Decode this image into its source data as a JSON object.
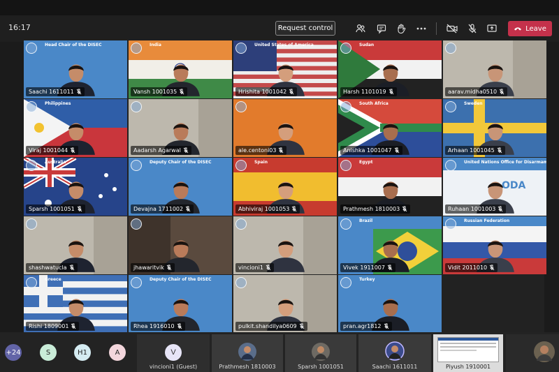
{
  "toolbar": {
    "clock": "16:17",
    "request_control": "Request control",
    "leave": "Leave",
    "icons": [
      "people-icon",
      "chat-icon",
      "raise-hand-icon",
      "more-icon",
      "camera-off-icon",
      "mic-off-icon",
      "share-tray-icon",
      "phone-icon"
    ],
    "leave_color": "#c4314b"
  },
  "tiles": [
    {
      "name": "Saachi 1611011",
      "title": "Head Chair of the DISEC",
      "flag": "un"
    },
    {
      "name": "Vansh 1001035",
      "title": "India",
      "flag": "india"
    },
    {
      "name": "Hrishita 1001042",
      "title": "United States of America",
      "flag": "usa"
    },
    {
      "name": "Harsh 1101019",
      "title": "Sudan",
      "flag": "sudan"
    },
    {
      "name": "aarav.midha0510",
      "title": "",
      "flag": "room"
    },
    {
      "name": "Viraj 1001044",
      "title": "Philippines",
      "flag": "philippines"
    },
    {
      "name": "Aadarsh Agarwal",
      "title": "",
      "flag": "room"
    },
    {
      "name": "ale.centoni03",
      "title": "",
      "flag": "orange"
    },
    {
      "name": "Anishka 1001047",
      "title": "South Africa",
      "flag": "south-africa"
    },
    {
      "name": "Arhaan 1001045",
      "title": "Sweden",
      "flag": "sweden"
    },
    {
      "name": "Sparsh 1001051",
      "title": "Australia",
      "flag": "australia"
    },
    {
      "name": "Devajna 1711002",
      "title": "Deputy Chair of the DISEC",
      "flag": "un"
    },
    {
      "name": "Abhiviraj 1001053",
      "title": "Spain",
      "flag": "spain"
    },
    {
      "name": "Prathmesh 1810003",
      "title": "Egypt",
      "flag": "egypt"
    },
    {
      "name": "Ruhaan 1001003",
      "title": "United Nations Office for Disarmament Affairs",
      "flag": "unoda"
    },
    {
      "name": "shashwatucla",
      "title": "",
      "flag": "room"
    },
    {
      "name": "jhawaritvik",
      "title": "",
      "flag": "dark-room"
    },
    {
      "name": "vincioni1",
      "title": "",
      "flag": "room"
    },
    {
      "name": "Vivek 1911007",
      "title": "Brazil",
      "flag": "brazil"
    },
    {
      "name": "Vidit 2011010",
      "title": "Russian Federation",
      "flag": "russia"
    },
    {
      "name": "Rishi 1809001",
      "title": "Greece",
      "flag": "greece"
    },
    {
      "name": "Rhea 1916010",
      "title": "Deputy Chair of the DISEC",
      "flag": "un"
    },
    {
      "name": "pulkit.shandilya0609",
      "title": "",
      "flag": "room"
    },
    {
      "name": "pran.agr1812",
      "title": "Turkey",
      "flag": "un"
    }
  ],
  "bottom": {
    "overflow_count": "+24",
    "avatars": [
      {
        "initials": "S",
        "bg": "#c9ecd8"
      },
      {
        "initials": "H1",
        "bg": "#d5ecf2"
      },
      {
        "initials": "A",
        "bg": "#f3d6dc"
      }
    ],
    "guest": {
      "initial": "V",
      "label": "vincioni1 (Guest)"
    },
    "thumbs": [
      {
        "label": "Prathmesh 1810003"
      },
      {
        "label": "Sparsh 1001051"
      },
      {
        "label": "Saachi 1611011"
      },
      {
        "label": "Piyush 1910001"
      }
    ]
  }
}
